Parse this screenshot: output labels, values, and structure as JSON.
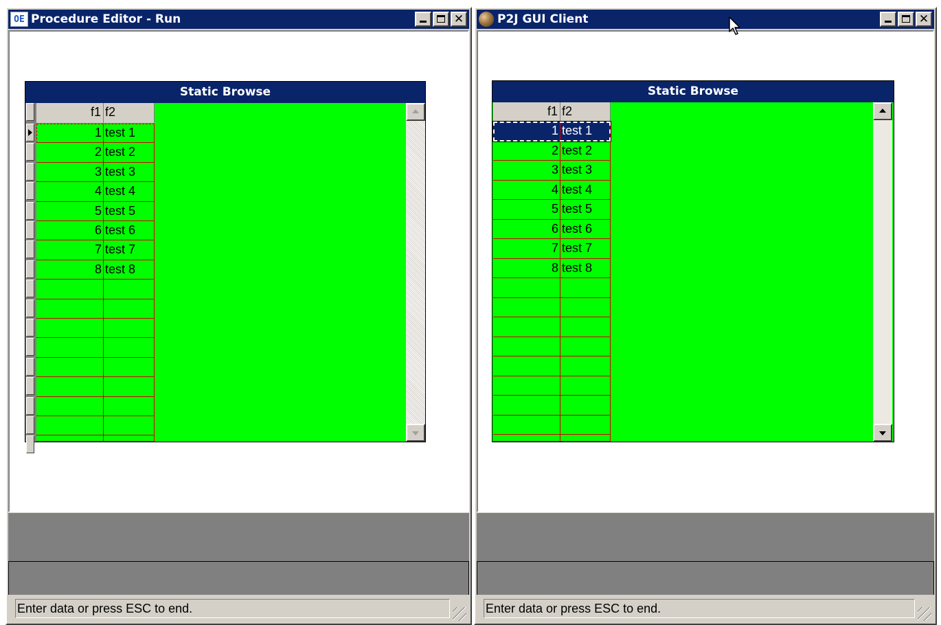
{
  "left_window": {
    "app_icon_text": "OE",
    "title": "Procedure Editor - Run",
    "browse": {
      "title": "Static Browse",
      "columns": [
        "f1",
        "f2"
      ],
      "rows": [
        {
          "f1": "1",
          "f2": "test 1"
        },
        {
          "f1": "2",
          "f2": "test 2"
        },
        {
          "f1": "3",
          "f2": "test 3"
        },
        {
          "f1": "4",
          "f2": "test 4"
        },
        {
          "f1": "5",
          "f2": "test 5"
        },
        {
          "f1": "6",
          "f2": "test 6"
        },
        {
          "f1": "7",
          "f2": "test 7"
        },
        {
          "f1": "8",
          "f2": "test 8"
        }
      ],
      "selected_row": 1
    },
    "status": "Enter data or press ESC to end."
  },
  "right_window": {
    "title": "P2J GUI Client",
    "browse": {
      "title": "Static Browse",
      "columns": [
        "f1",
        "f2"
      ],
      "rows": [
        {
          "f1": "1",
          "f2": "test 1"
        },
        {
          "f1": "2",
          "f2": "test 2"
        },
        {
          "f1": "3",
          "f2": "test 3"
        },
        {
          "f1": "4",
          "f2": "test 4"
        },
        {
          "f1": "5",
          "f2": "test 5"
        },
        {
          "f1": "6",
          "f2": "test 6"
        },
        {
          "f1": "7",
          "f2": "test 7"
        },
        {
          "f1": "8",
          "f2": "test 8"
        }
      ],
      "selected_row": 1
    },
    "status": "Enter data or press ESC to end."
  },
  "colors": {
    "title_bar": "#0a246a",
    "browse_background": "#00ff00",
    "grid_lines": "#d40000",
    "selection": "#0a246a"
  },
  "icons": {
    "left_app_icon": "oe-logo-icon",
    "right_app_icon": "globe-icon",
    "minimize": "minimize-icon",
    "maximize": "maximize-icon",
    "close": "close-icon",
    "scroll_up": "arrow-up-icon",
    "scroll_down": "arrow-down-icon",
    "size_grip": "size-grip-icon",
    "cursor": "mouse-pointer-icon"
  }
}
